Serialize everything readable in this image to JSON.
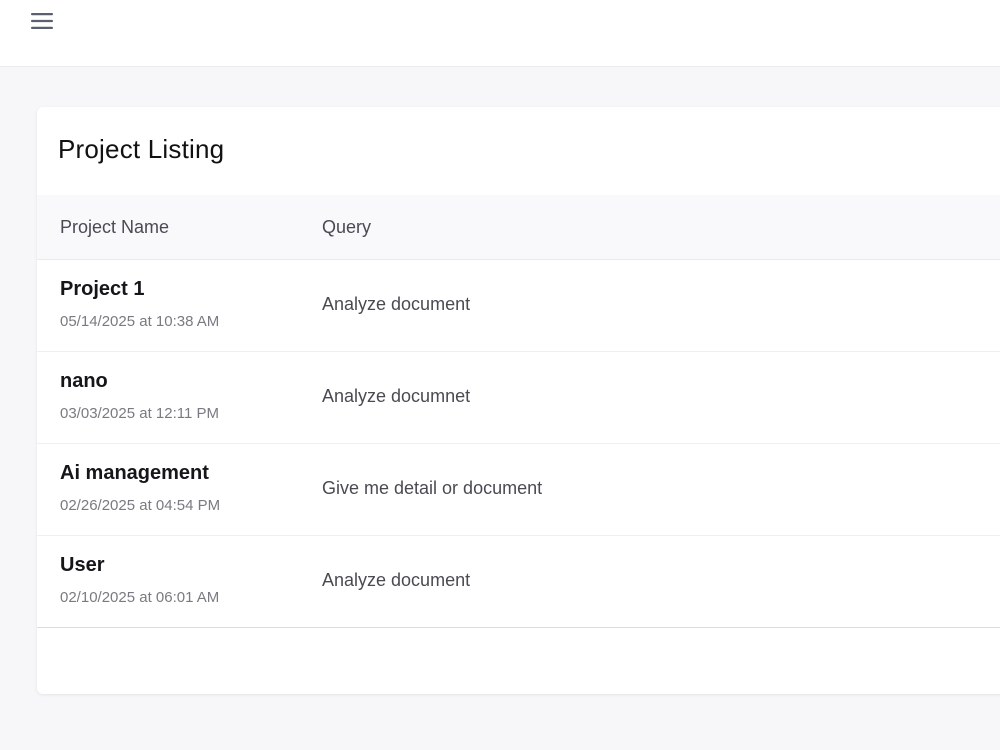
{
  "header": {
    "menu_icon": "hamburger-menu-icon"
  },
  "main": {
    "title": "Project Listing",
    "columns": [
      "Project Name",
      "Query"
    ],
    "projects": [
      {
        "name": "Project 1",
        "date": "05/14/2025 at 10:38 AM",
        "query": "Analyze document"
      },
      {
        "name": "nano",
        "date": "03/03/2025 at 12:11 PM",
        "query": "Analyze documnet"
      },
      {
        "name": "Ai management",
        "date": "02/26/2025 at 04:54 PM",
        "query": "Give me detail or document"
      },
      {
        "name": "User",
        "date": "02/10/2025 at 06:01 AM",
        "query": "Analyze document"
      }
    ]
  },
  "colors": {
    "background": "#f7f7f9",
    "card": "#ffffff",
    "header_row": "#f9f9fc",
    "text_primary": "#15151a",
    "text_secondary": "#4a4a52",
    "text_muted": "#7a7a82",
    "icon": "#5a6070"
  }
}
